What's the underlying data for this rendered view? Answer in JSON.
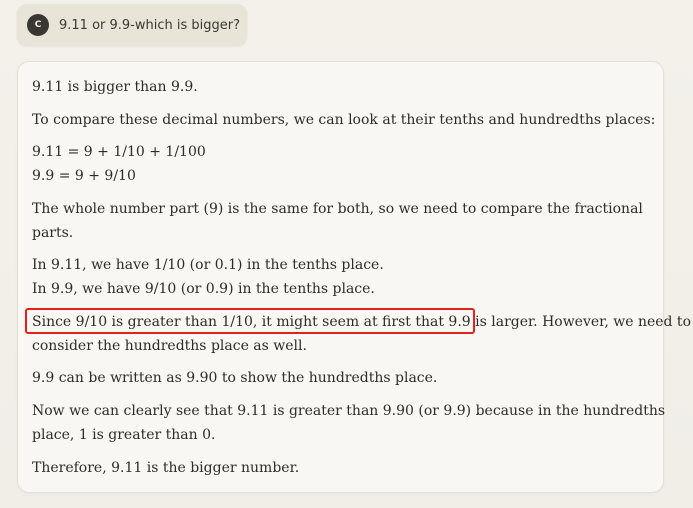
{
  "user_message": {
    "avatar_initial": "C",
    "text": "9.11 or 9.9-which is bigger?"
  },
  "response": {
    "lines": [
      "9.11 is bigger than 9.9.",
      "To compare these decimal numbers, we can look at their tenths and hundredths places:",
      "9.11 = 9 + 1/10 + 1/100",
      "9.9 = 9 + 9/10",
      "The whole number part (9) is the same for both, so we need to compare the fractional",
      "parts.",
      "In 9.11, we have 1/10 (or 0.1) in the tenths place.",
      "In 9.9, we have 9/10 (or 0.9) in the tenths place.",
      "Since 9/10 is greater than 1/10, it might seem at first that 9.9 is larger. However, we need to",
      "consider the hundredths place as well.",
      "9.9 can be written as 9.90 to show the hundredths place.",
      "Now we can clearly see that 9.11 is greater than 9.90 (or 9.9) because in the hundredths",
      "place, 1 is greater than 0.",
      "Therefore, 9.11 is the bigger number."
    ]
  },
  "colors": {
    "highlight_border": "#e0241b",
    "avatar_bg": "#3a3733",
    "user_bubble_bg": "#e8e4d7",
    "card_bg": "#f8f7f3"
  }
}
